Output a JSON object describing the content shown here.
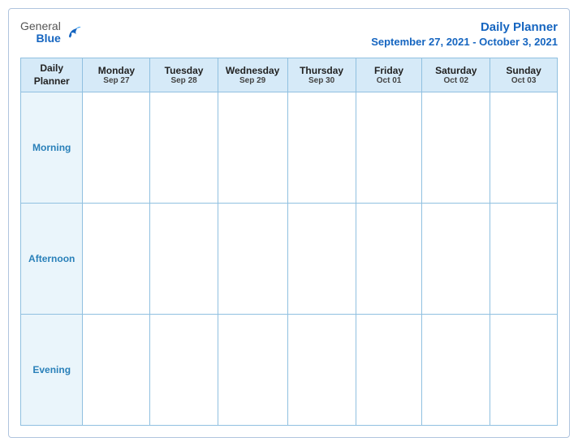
{
  "header": {
    "logo_general": "General",
    "logo_blue": "Blue",
    "title": "Daily Planner",
    "date_range": "September 27, 2021 - October 3, 2021"
  },
  "table": {
    "first_header": {
      "line1": "Daily",
      "line2": "Planner"
    },
    "columns": [
      {
        "day": "Monday",
        "date": "Sep 27"
      },
      {
        "day": "Tuesday",
        "date": "Sep 28"
      },
      {
        "day": "Wednesday",
        "date": "Sep 29"
      },
      {
        "day": "Thursday",
        "date": "Sep 30"
      },
      {
        "day": "Friday",
        "date": "Oct 01"
      },
      {
        "day": "Saturday",
        "date": "Oct 02"
      },
      {
        "day": "Sunday",
        "date": "Oct 03"
      }
    ],
    "rows": [
      {
        "label": "Morning"
      },
      {
        "label": "Afternoon"
      },
      {
        "label": "Evening"
      }
    ]
  }
}
